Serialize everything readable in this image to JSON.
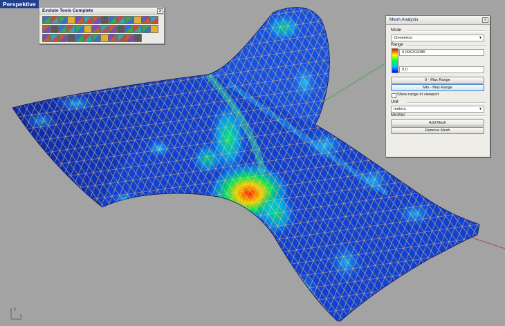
{
  "viewport": {
    "name": "Perspektive"
  },
  "colors": {
    "mesh_low": "#0033cc",
    "mesh_high": "#ff2000",
    "wire": "#f0d070",
    "bg": "#a3a3a3"
  },
  "toolbar": {
    "title": "Evolute Tools Complete",
    "close": "x",
    "icons": [
      "e-logo-icon",
      "subdivide-icon",
      "mesh-relax-icon",
      "triangle-mesh-icon",
      "quad-mesh-icon",
      "hex-mesh-icon",
      "planarize-icon",
      "pyramid-icon",
      "dome-icon",
      "offset-icon",
      "panel-icon",
      "tools-icon",
      "settings-icon",
      "close-tool-icon",
      "layers-icon",
      "add-vertex-icon",
      "delete-icon",
      "quad-grid-icon",
      "triangle-grid-icon",
      "grid-blue-icon",
      "grid-red-icon",
      "grid-multi-icon",
      "grid-dark-icon",
      "grid-colored-icon",
      "analysis-icon",
      "flag-icon",
      "color-bar-icon",
      "info-icon",
      "pencil-icon",
      "star-icon",
      "dual-icon",
      "hexagon-icon",
      "refine-icon",
      "split-icon",
      "pin-icon",
      "mesh-small-icon",
      "bucket-icon",
      "bucket-2-icon",
      "bucket-3-icon",
      "bucket-4-icon"
    ]
  },
  "mesh_analysis": {
    "title": "Mesh Analysis",
    "close": "x",
    "mode_label": "Mode",
    "mode_value": "Closeness",
    "range_label": "Range",
    "range_max": "0.096202085",
    "range_min": "0.0",
    "btn_zero_max": "0 - Max Range",
    "btn_min_max": "Min - Max Range",
    "show_range_label": "Show range in viewport",
    "show_range_checked": false,
    "unit_label": "Unit",
    "unit_value": "meters",
    "meshes_label": "Meshes",
    "btn_add_mesh": "Add Mesh",
    "btn_remove_mesh": "Remove Mesh"
  },
  "axes_widget": {
    "x": "x",
    "y": "y"
  }
}
